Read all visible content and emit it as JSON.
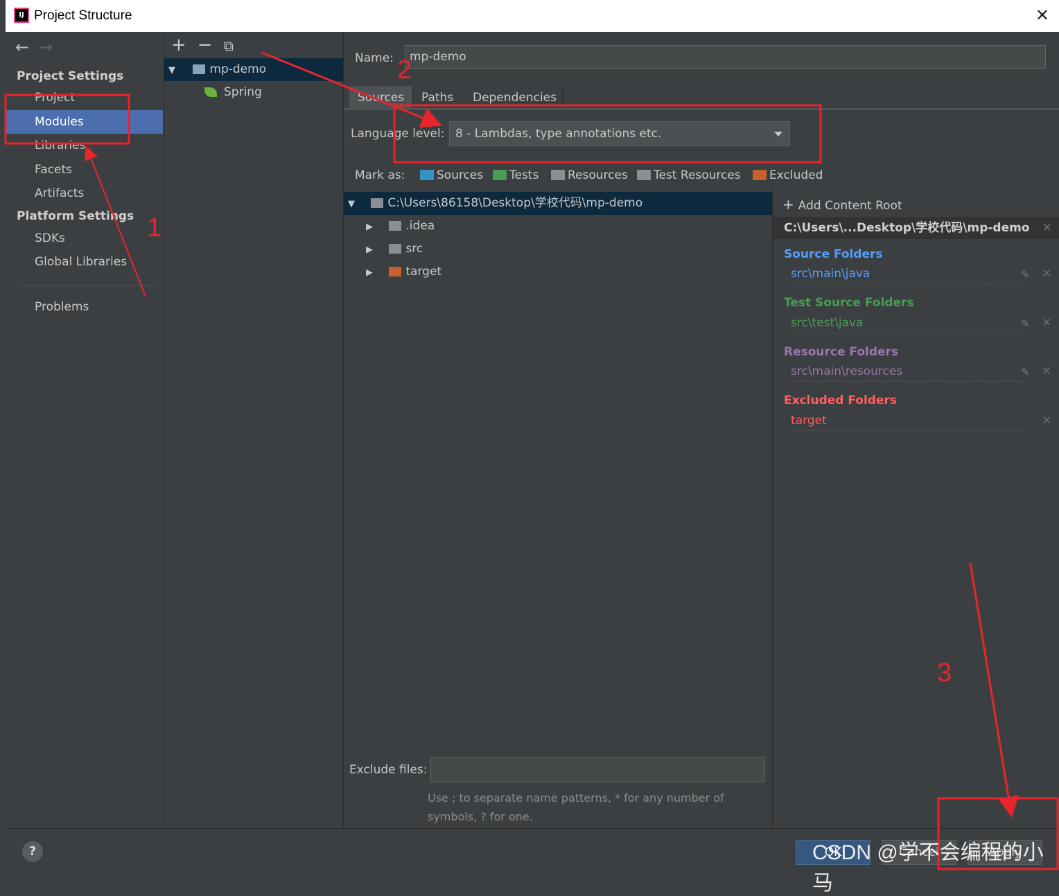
{
  "window": {
    "title": "Project Structure",
    "close_glyph": "✕"
  },
  "nav": {
    "back": "←",
    "forward": "→",
    "project_settings_header": "Project Settings",
    "project_items": [
      "Project",
      "Modules",
      "Libraries",
      "Facets",
      "Artifacts"
    ],
    "selected": "Modules",
    "platform_settings_header": "Platform Settings",
    "platform_items": [
      "SDKs",
      "Global Libraries"
    ],
    "problems": "Problems"
  },
  "modules_toolbar": {
    "add": "+",
    "remove": "−",
    "copy": "⧉"
  },
  "module_tree": {
    "module": "mp-demo",
    "facet": "Spring"
  },
  "name": {
    "label": "Name:",
    "value": "mp-demo"
  },
  "tabs": [
    "Sources",
    "Paths",
    "Dependencies"
  ],
  "language_level": {
    "label": "Language level:",
    "value": "8 - Lambdas, type annotations etc."
  },
  "mark_as": {
    "label": "Mark as:",
    "items": [
      {
        "label": "Sources",
        "color": "#3592c4"
      },
      {
        "label": "Tests",
        "color": "#499c54"
      },
      {
        "label": "Resources",
        "color": "#8a8f93"
      },
      {
        "label": "Test Resources",
        "color": "#8a8f93"
      },
      {
        "label": "Excluded",
        "color": "#c75f2f"
      }
    ]
  },
  "file_tree": {
    "root": "C:\\Users\\86158\\Desktop\\学校代码\\mp-demo",
    "children": [
      ".idea",
      "src",
      "target"
    ]
  },
  "exclude_files": {
    "label": "Exclude files:",
    "hint": "Use ; to separate name patterns, * for any number of symbols, ? for one."
  },
  "content_roots": {
    "add_label": "Add Content Root",
    "root_path": "C:\\Users\\...Desktop\\学校代码\\mp-demo",
    "source_header": "Source Folders",
    "source_value": "src\\main\\java",
    "test_header": "Test Source Folders",
    "test_value": "src\\test\\java",
    "resource_header": "Resource Folders",
    "resource_value": "src\\main\\resources",
    "excluded_header": "Excluded Folders",
    "excluded_value": "target",
    "colors": {
      "source": "#589df6",
      "test": "#499c54",
      "resource": "#9876aa",
      "excluded": "#ff5f5f"
    }
  },
  "buttons": {
    "help": "?",
    "ok": "OK",
    "cancel": "Cancel",
    "apply": "Apply"
  },
  "annotations": {
    "n1": "1",
    "n2": "2",
    "n3": "3",
    "color": "#e8252c"
  },
  "watermark": "CSDN @学不会编程的小马"
}
